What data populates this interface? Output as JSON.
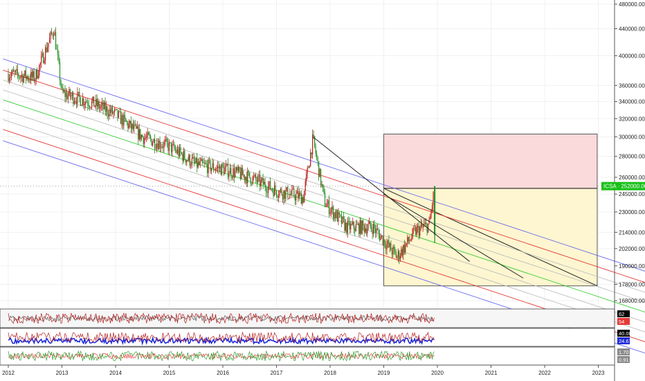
{
  "chart_data": {
    "type": "candlestick",
    "symbol_badge": "ICSA · 252000.00",
    "last_value": 252000,
    "y_axis": {
      "scale": "log",
      "range": [
        158000,
        500000
      ],
      "tick_labels": [
        "480000.00",
        "440000.00",
        "400000.00",
        "360000.00",
        "340000.00",
        "320000.00",
        "300000.00",
        "280000.00",
        "260000.00",
        "245000.00",
        "230000.00",
        "214000.00",
        "202000.00",
        "190000.00",
        "178000.00",
        "168000.00"
      ],
      "tick_values": [
        480000,
        440000,
        400000,
        360000,
        340000,
        320000,
        300000,
        280000,
        260000,
        245000,
        230000,
        214000,
        202000,
        190000,
        178000,
        168000
      ]
    },
    "x_axis": {
      "labels": [
        "2012",
        "2013",
        "2014",
        "2015",
        "2016",
        "2017",
        "2018",
        "2019",
        "2020",
        "2021",
        "2022",
        "2023"
      ],
      "values": [
        2012,
        2013,
        2014,
        2015,
        2016,
        2017,
        2018,
        2019,
        2020,
        2021,
        2022,
        2023
      ],
      "range": [
        2012,
        2024
      ]
    },
    "key_points": [
      {
        "t": 2012.0,
        "v": 375000
      },
      {
        "t": 2012.5,
        "v": 370000
      },
      {
        "t": 2012.85,
        "v": 440000
      },
      {
        "t": 2013.0,
        "v": 350000
      },
      {
        "t": 2013.5,
        "v": 340000
      },
      {
        "t": 2014.0,
        "v": 325000
      },
      {
        "t": 2014.5,
        "v": 300000
      },
      {
        "t": 2015.0,
        "v": 290000
      },
      {
        "t": 2015.5,
        "v": 272000
      },
      {
        "t": 2016.0,
        "v": 268000
      },
      {
        "t": 2016.5,
        "v": 260000
      },
      {
        "t": 2017.0,
        "v": 248000
      },
      {
        "t": 2017.5,
        "v": 242000
      },
      {
        "t": 2017.68,
        "v": 298000
      },
      {
        "t": 2017.9,
        "v": 238000
      },
      {
        "t": 2018.3,
        "v": 218000
      },
      {
        "t": 2018.8,
        "v": 218000
      },
      {
        "t": 2019.25,
        "v": 196000
      },
      {
        "t": 2019.6,
        "v": 215000
      },
      {
        "t": 2019.85,
        "v": 220000
      },
      {
        "t": 2019.95,
        "v": 252000
      }
    ],
    "regression_channel": {
      "center": [
        {
          "t": 2012,
          "v": 340000
        },
        {
          "t": 2024,
          "v": 160000
        }
      ],
      "log_offsets": [
        -0.145,
        -0.105,
        -0.07,
        -0.035,
        0,
        0.035,
        0.07,
        0.105,
        0.145
      ],
      "line_colors": [
        "#6a6af0",
        "#e53935",
        "#bdbdbd",
        "#bdbdbd",
        "#33cc33",
        "#bdbdbd",
        "#bdbdbd",
        "#e53935",
        "#6a6af0"
      ]
    },
    "trendlines": [
      {
        "from": {
          "t": 2017.68,
          "v": 300000
        },
        "to": {
          "t": 2020.6,
          "v": 193000
        }
      },
      {
        "from": {
          "t": 2019.0,
          "v": 245000
        },
        "to": {
          "t": 2021.6,
          "v": 182000
        }
      }
    ],
    "position_tool": {
      "t_start": 2019.0,
      "t_end": 2022.98,
      "entry": 250000,
      "stop": 303000,
      "target": 177000,
      "stop_color": "#fadadb",
      "target_color": "#fdf6d0"
    },
    "indicators": [
      {
        "name": "",
        "values_shown": [
          "62",
          "54"
        ],
        "badge_colors": [
          "#000000",
          "#e53935"
        ]
      },
      {
        "name": "",
        "values_shown": [
          "40.00",
          "24.67"
        ],
        "badge_colors": [
          "#000000",
          "#1e2ad8"
        ]
      },
      {
        "name": "",
        "values_shown": [
          "1.70",
          "0.91"
        ],
        "badge_colors": [
          "#8a8a8a",
          "#8a8a8a"
        ]
      }
    ],
    "colors": {
      "bull": "#1e8c1e",
      "bear": "#b71c1c",
      "badge": "#18c018",
      "grid": "#f0f0f0"
    }
  }
}
